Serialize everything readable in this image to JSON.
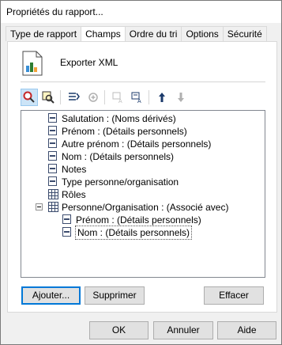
{
  "window": {
    "title": "Propriétés du rapport..."
  },
  "tabs": [
    {
      "label": "Type de rapport"
    },
    {
      "label": "Champs"
    },
    {
      "label": "Ordre du tri"
    },
    {
      "label": "Options"
    },
    {
      "label": "Sécurité"
    }
  ],
  "panel": {
    "export_label": "Exporter XML"
  },
  "tree": {
    "items": [
      {
        "label": "Salutation : (Noms dérivés)",
        "type": "field"
      },
      {
        "label": "Prénom : (Détails personnels)",
        "type": "field"
      },
      {
        "label": "Autre prénom : (Détails personnels)",
        "type": "field"
      },
      {
        "label": "Nom : (Détails personnels)",
        "type": "field"
      },
      {
        "label": "Notes",
        "type": "field"
      },
      {
        "label": "Type personne/organisation",
        "type": "field"
      },
      {
        "label": "Rôles",
        "type": "table"
      },
      {
        "label": "Personne/Organisation : (Associé avec)",
        "type": "table",
        "expanded": true
      },
      {
        "label": "Prénom : (Détails personnels)",
        "type": "field"
      },
      {
        "label": "Nom : (Détails personnels)",
        "type": "field",
        "selected": true
      }
    ]
  },
  "buttons": {
    "add": "Ajouter...",
    "remove": "Supprimer",
    "clear": "Effacer",
    "ok": "OK",
    "cancel": "Annuler",
    "help": "Aide"
  }
}
